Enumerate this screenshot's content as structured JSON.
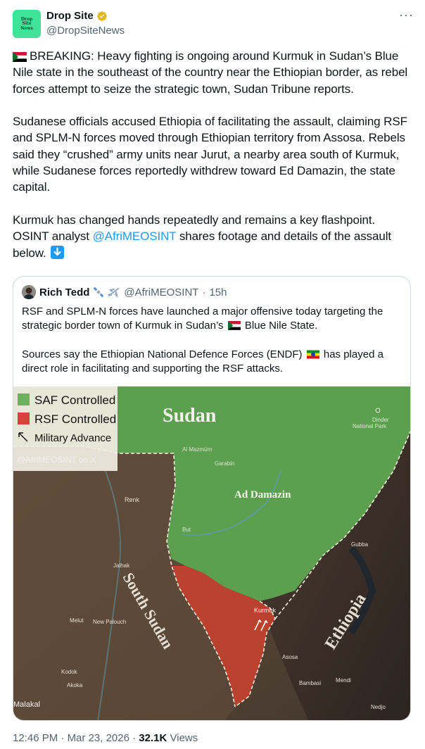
{
  "author": {
    "avatar_text": "Drop\nSite\nNews",
    "name": "Drop Site",
    "handle": "@DropSiteNews",
    "more_label": "···"
  },
  "tweet": {
    "p1": "BREAKING: Heavy fighting is ongoing around Kurmuk in Sudan’s Blue Nile state in the southeast of the country near the Ethiopian border, as rebel forces attempt to seize the strategic town, Sudan Tribune reports.",
    "p2": "Sudanese officials accused Ethiopia of facilitating the assault, claiming RSF and SPLM-N forces moved through Ethiopian territory from Assosa. Rebels said they “crushed” army units near Jurut, a nearby area south of Kurmuk, while Sudanese forces reportedly withdrew toward Ed Damazin, the state capital.",
    "p3_a": "Kurmuk has changed hands repeatedly and remains a key flashpoint. OSINT analyst ",
    "p3_mention": "@AfriMEOSINT",
    "p3_b": " shares footage and details of the assault below."
  },
  "quote": {
    "name": "Rich Tedd",
    "handle": "@AfriMEOSINT",
    "dot": "·",
    "time": "15h",
    "p1_a": "RSF and SPLM-N forces have launched a major offensive today targeting the strategic border town of Kurmuk in Sudan’s",
    "p1_b": "Blue Nile State.",
    "p2_a": "Sources say the Ethiopian National Defence Forces (ENDF)",
    "p2_b": "has played a direct role in facilitating and supporting the RSF attacks."
  },
  "map": {
    "legend": {
      "saf": "SAF Controlled",
      "rsf": "RSF Controlled",
      "advance": "Military Advance",
      "credit": "@AfriMEOSINT on X"
    },
    "labels": {
      "sudan": "Sudan",
      "south_sudan": "South Sudan",
      "ethiopia": "Ethiopia",
      "ad_damazin": "Ad Damazin",
      "dinder": "Dinder\nNational Park",
      "al_mazmum": "Al Mazmūm",
      "garabin": "Garabin",
      "renk": "Renk",
      "but": "But",
      "jalhak": "Jalhak",
      "gubba": "Gubba",
      "kurmuk": "Kurmuk",
      "melut": "Melut",
      "new_palouch": "New Palouch",
      "kodok": "Kodok",
      "akoka": "Akoka",
      "malakal": "Malakal",
      "asosa": "Asosa",
      "bambasi": "Bambasi",
      "mendi": "Mendi",
      "nedjo": "Nedjo"
    },
    "colors": {
      "saf": "#6db05f",
      "rsf": "#d5443c"
    }
  },
  "footer": {
    "time": "12:46 PM",
    "sep": " · ",
    "date": "Mar 23, 2026",
    "views_count": "32.1K",
    "views_label": "Views"
  }
}
